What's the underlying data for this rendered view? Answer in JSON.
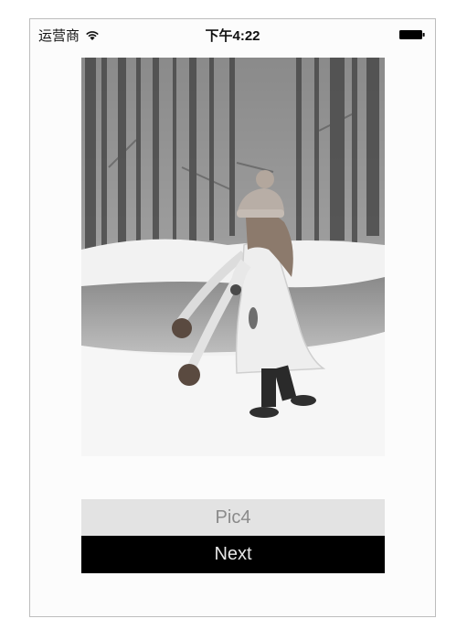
{
  "status_bar": {
    "carrier": "运营商",
    "time": "下午4:22",
    "wifi_icon": "wifi-icon",
    "battery_icon": "battery-icon"
  },
  "photo": {
    "description_icon": "winter-child-photo"
  },
  "picture_label": "Pic4",
  "next_button_label": "Next",
  "colors": {
    "label_background": "#e3e3e3",
    "button_background": "#000000",
    "button_text": "#e7e7e7"
  }
}
